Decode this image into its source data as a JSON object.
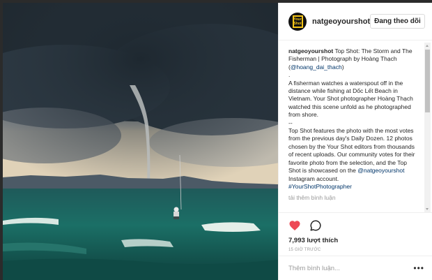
{
  "post": {
    "username": "natgeoyourshot",
    "avatar_text": "Your Shot",
    "follow_label": "Đang theo dõi",
    "caption_user": "natgeoyourshot",
    "caption_title": " Top Shot: The Storm and The Fisherman | Photograph by Hoàng Thạch (",
    "caption_mention": "@hoang_dai_thach",
    "caption_title_end": ")",
    "caption_dot": ".",
    "caption_p1": "A fisherman watches a waterspout off in the distance while fishing at Dốc Lết Beach in Vietnam. Your Shot photographer Hoàng Thạch watched this scene unfold as he photographed from shore.",
    "caption_sep": "--",
    "caption_p2": "Top Shot features the photo with the most votes from the previous day's Daily Dozen. 12 photos chosen by the Your Shot editors from thousands of recent uploads. Our community votes for their favorite photo from the selection, and the Top Shot is showcased on the ",
    "caption_p2_mention": "@natgeoyourshot",
    "caption_p2_end": " Instagram account.",
    "caption_hashtag": "#YourShotPhotographer",
    "load_more": "tải thêm bình luận",
    "likes": "7,993 lượt thích",
    "time": "15 GIỜ TRƯỚC",
    "comment_placeholder": "Thêm bình luận...",
    "more_label": "•••"
  },
  "icons": {
    "like": "heart-icon",
    "comment": "comment-icon",
    "more": "more-icon"
  },
  "colors": {
    "like_heart": "#ed4956",
    "link": "#003569",
    "muted": "#999999",
    "avatar_yellow": "#f5c518"
  }
}
